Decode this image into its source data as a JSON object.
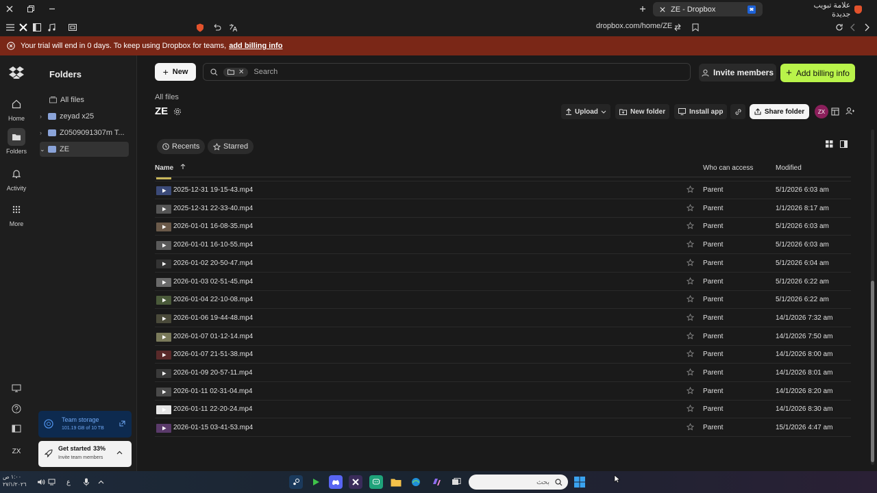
{
  "browser": {
    "active_tab_title": "ZE - Dropbox",
    "new_tab_label": "علامة تبويب جديدة",
    "url": "dropbox.com/home/ZE"
  },
  "banner": {
    "text": "Your trial will end in 0 days. To keep using Dropbox for teams,",
    "link": "add billing info"
  },
  "rail": {
    "home": "Home",
    "folders": "Folders",
    "activity": "Activity",
    "more": "More",
    "avatar": "ZX"
  },
  "panel": {
    "title": "Folders",
    "items": [
      {
        "label": "All files"
      },
      {
        "label": "zeyad x25"
      },
      {
        "label": "Z0509091307m T..."
      },
      {
        "label": "ZE"
      }
    ],
    "storage_title": "Team storage",
    "storage_detail": "101.19 GB of 10 TB",
    "getstarted_title": "Get started",
    "getstarted_pct": "33%",
    "getstarted_sub": "Invite team members"
  },
  "main": {
    "new_label": "New",
    "search_placeholder": "Search",
    "invite_label": "Invite members",
    "billing_label": "Add billing info",
    "breadcrumb": "All files",
    "folder_title": "ZE",
    "upload_label": "Upload",
    "newfolder_label": "New folder",
    "installapp_label": "Install app",
    "share_label": "Share folder",
    "avatar": "ZX",
    "recents_label": "Recents",
    "starred_label": "Starred",
    "col_name": "Name",
    "col_access": "Who can access",
    "col_modified": "Modified"
  },
  "files": [
    {
      "name": "2025-12-31 19-15-43.mp4",
      "access": "Parent",
      "modified": "5/1/2026 6:03 am"
    },
    {
      "name": "2025-12-31 22-33-40.mp4",
      "access": "Parent",
      "modified": "1/1/2026 8:17 am"
    },
    {
      "name": "2026-01-01 16-08-35.mp4",
      "access": "Parent",
      "modified": "5/1/2026 6:03 am"
    },
    {
      "name": "2026-01-01 16-10-55.mp4",
      "access": "Parent",
      "modified": "5/1/2026 6:03 am"
    },
    {
      "name": "2026-01-02 20-50-47.mp4",
      "access": "Parent",
      "modified": "5/1/2026 6:04 am"
    },
    {
      "name": "2026-01-03 02-51-45.mp4",
      "access": "Parent",
      "modified": "5/1/2026 6:22 am"
    },
    {
      "name": "2026-01-04 22-10-08.mp4",
      "access": "Parent",
      "modified": "5/1/2026 6:22 am"
    },
    {
      "name": "2026-01-06 19-44-48.mp4",
      "access": "Parent",
      "modified": "14/1/2026 7:32 am"
    },
    {
      "name": "2026-01-07 01-12-14.mp4",
      "access": "Parent",
      "modified": "14/1/2026 7:50 am"
    },
    {
      "name": "2026-01-07 21-51-38.mp4",
      "access": "Parent",
      "modified": "14/1/2026 8:00 am"
    },
    {
      "name": "2026-01-09 20-57-11.mp4",
      "access": "Parent",
      "modified": "14/1/2026 8:01 am"
    },
    {
      "name": "2026-01-11 02-31-04.mp4",
      "access": "Parent",
      "modified": "14/1/2026 8:20 am"
    },
    {
      "name": "2026-01-11 22-20-24.mp4",
      "access": "Parent",
      "modified": "14/1/2026 8:30 am"
    },
    {
      "name": "2026-01-15 03-41-53.mp4",
      "access": "Parent",
      "modified": "15/1/2026 4:47 am"
    }
  ],
  "taskbar": {
    "search_placeholder": "بحث",
    "time": "١:٠٠ ص",
    "date": "٢٧/١/٢٠٢٦",
    "lang": "ع"
  },
  "colors": {
    "banner": "#7a2717",
    "billing_button": "#b9f34a",
    "avatar": "#8b1f5b",
    "storage_card": "#0d2a4f"
  }
}
